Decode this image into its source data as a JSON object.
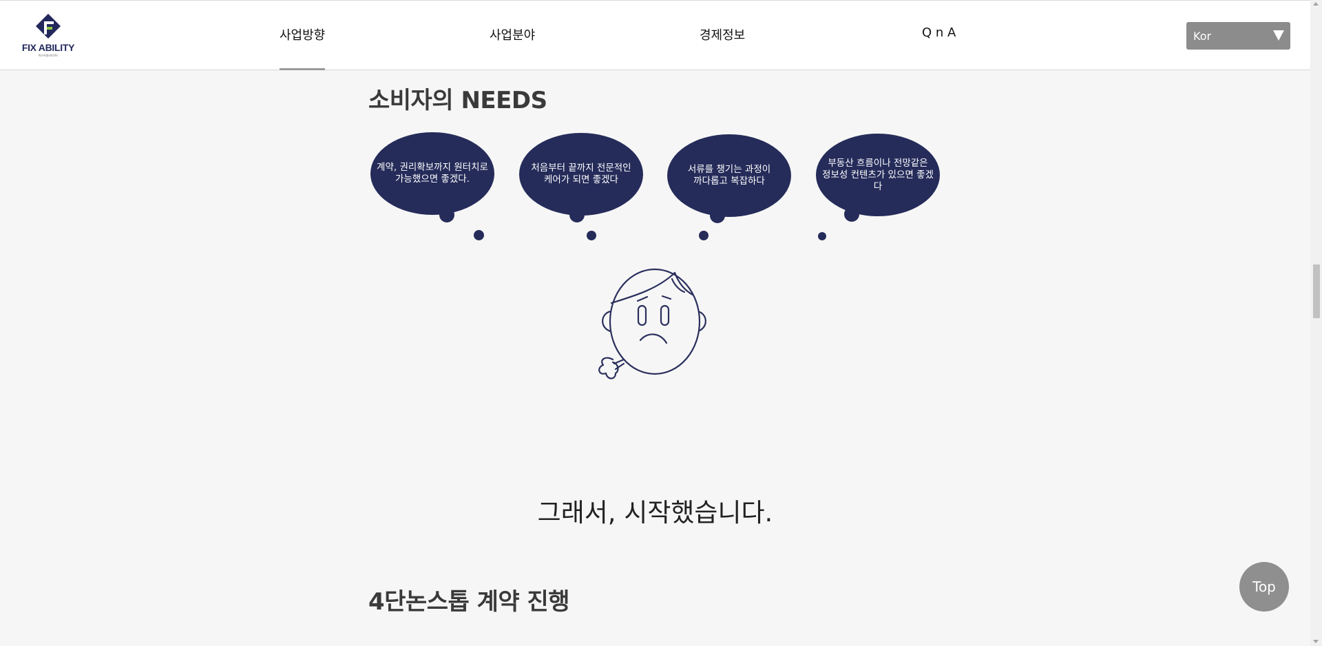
{
  "header": {
    "logo_text": "FIX ABILITY",
    "logo_sub": "픽스어빌리티(주)",
    "nav": [
      {
        "label": "사업방향",
        "active": true
      },
      {
        "label": "사업분야",
        "active": false
      },
      {
        "label": "경제정보",
        "active": false
      },
      {
        "label": "Q n A",
        "active": false
      }
    ],
    "language": {
      "selected": "Kor"
    }
  },
  "needs": {
    "title": "소비자의 NEEDS",
    "bubbles": [
      {
        "line1": "계약, 권리확보까지 원터치로",
        "line2": "가능했으면 좋겠다."
      },
      {
        "line1": "처음부터 끝까지 전문적인",
        "line2": "케어가 되면 좋겠다"
      },
      {
        "line1": "서류를 챙기는 과정이",
        "line2": "까다롭고 복잡하다"
      },
      {
        "line1": "부동산 흐름이나 전망같은",
        "line2": "정보성 컨텐츠가 있으면 좋겠다"
      }
    ]
  },
  "tagline": "그래서, 시작했습니다.",
  "contract": {
    "title": "4단논스톱 계약 진행"
  },
  "top_button": "Top",
  "colors": {
    "accent": "#252c5a",
    "logo": "#23285c",
    "logo_green": "#8cc63f",
    "gray_button": "#8f8f8f"
  }
}
